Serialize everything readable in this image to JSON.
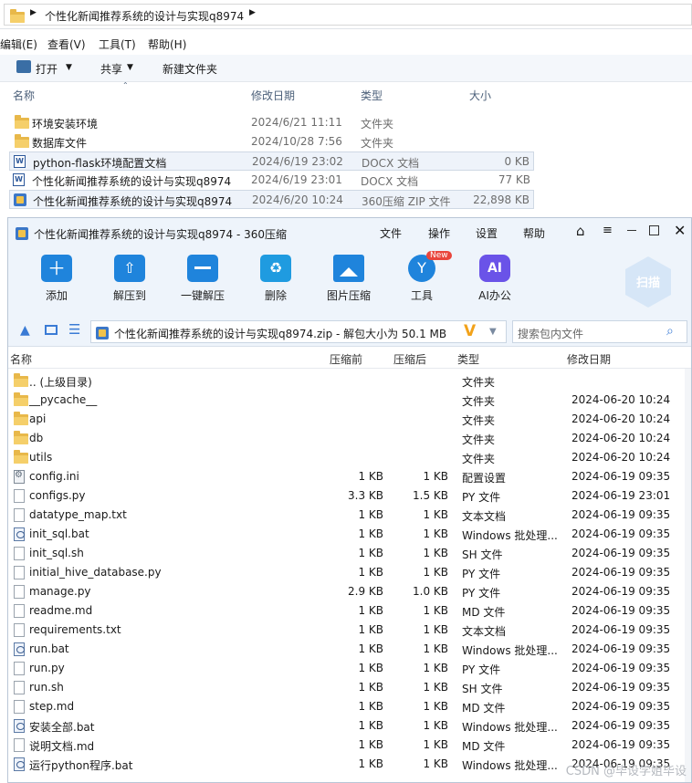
{
  "explorer": {
    "breadcrumb": "个性化新闻推荐系统的设计与实现q8974",
    "menu": [
      "编辑(E)",
      "查看(V)",
      "工具(T)",
      "帮助(H)"
    ],
    "toolbar": {
      "open": "打开",
      "share": "共享",
      "new_folder": "新建文件夹"
    },
    "columns": {
      "name": "名称",
      "date": "修改日期",
      "type": "类型",
      "size": "大小"
    },
    "rows": [
      {
        "name": "环境安装环境",
        "date": "2024/6/21 11:11",
        "type": "文件夹",
        "size": "",
        "icon": "folder-icon"
      },
      {
        "name": "数据库文件",
        "date": "2024/10/28 7:56",
        "type": "文件夹",
        "size": "",
        "icon": "folder-icon"
      },
      {
        "name": "python-flask环境配置文档",
        "date": "2024/6/19 23:02",
        "type": "DOCX 文档",
        "size": "0 KB",
        "icon": "word-icon"
      },
      {
        "name": "个性化新闻推荐系统的设计与实现q8974",
        "date": "2024/6/19 23:01",
        "type": "DOCX 文档",
        "size": "77 KB",
        "icon": "word-icon"
      },
      {
        "name": "个性化新闻推荐系统的设计与实现q8974",
        "date": "2024/6/20 10:24",
        "type": "360压缩 ZIP 文件",
        "size": "22,898 KB",
        "icon": "zip-icon"
      }
    ]
  },
  "zip": {
    "title": "个性化新闻推荐系统的设计与实现q8974 - 360压缩",
    "menu": [
      "文件",
      "操作",
      "设置",
      "帮助"
    ],
    "toolbar": [
      {
        "label": "添加",
        "icon": "add-icon"
      },
      {
        "label": "解压到",
        "icon": "extract-to-icon"
      },
      {
        "label": "一键解压",
        "icon": "one-click-extract-icon"
      },
      {
        "label": "删除",
        "icon": "delete-icon"
      },
      {
        "label": "图片压缩",
        "icon": "image-compress-icon"
      },
      {
        "label": "工具",
        "icon": "tools-icon"
      },
      {
        "label": "AI办公",
        "icon": "ai-office-icon"
      }
    ],
    "new_badge": "New",
    "ai_glyph": "AI",
    "scan_label": "扫描",
    "path": "个性化新闻推荐系统的设计与实现q8974.zip - 解包大小为 50.1 MB",
    "search_placeholder": "搜索包内文件",
    "columns": {
      "name": "名称",
      "before": "压缩前",
      "after": "压缩后",
      "type": "类型",
      "date": "修改日期"
    },
    "rows": [
      {
        "name": ".. (上级目录)",
        "before": "",
        "after": "",
        "type": "文件夹",
        "date": "",
        "icon": "folder"
      },
      {
        "name": "__pycache__",
        "before": "",
        "after": "",
        "type": "文件夹",
        "date": "2024-06-20 10:24",
        "icon": "folder"
      },
      {
        "name": "api",
        "before": "",
        "after": "",
        "type": "文件夹",
        "date": "2024-06-20 10:24",
        "icon": "folder"
      },
      {
        "name": "db",
        "before": "",
        "after": "",
        "type": "文件夹",
        "date": "2024-06-20 10:24",
        "icon": "folder"
      },
      {
        "name": "utils",
        "before": "",
        "after": "",
        "type": "文件夹",
        "date": "2024-06-20 10:24",
        "icon": "folder"
      },
      {
        "name": "config.ini",
        "before": "1 KB",
        "after": "1 KB",
        "type": "配置设置",
        "date": "2024-06-19 09:35",
        "icon": "gear"
      },
      {
        "name": "configs.py",
        "before": "3.3 KB",
        "after": "1.5 KB",
        "type": "PY 文件",
        "date": "2024-06-19 23:01",
        "icon": "file"
      },
      {
        "name": "datatype_map.txt",
        "before": "1 KB",
        "after": "1 KB",
        "type": "文本文档",
        "date": "2024-06-19 09:35",
        "icon": "file"
      },
      {
        "name": "init_sql.bat",
        "before": "1 KB",
        "after": "1 KB",
        "type": "Windows 批处理...",
        "date": "2024-06-19 09:35",
        "icon": "bat"
      },
      {
        "name": "init_sql.sh",
        "before": "1 KB",
        "after": "1 KB",
        "type": "SH 文件",
        "date": "2024-06-19 09:35",
        "icon": "file"
      },
      {
        "name": "initial_hive_database.py",
        "before": "1 KB",
        "after": "1 KB",
        "type": "PY 文件",
        "date": "2024-06-19 09:35",
        "icon": "file"
      },
      {
        "name": "manage.py",
        "before": "2.9 KB",
        "after": "1.0 KB",
        "type": "PY 文件",
        "date": "2024-06-19 09:35",
        "icon": "file"
      },
      {
        "name": "readme.md",
        "before": "1 KB",
        "after": "1 KB",
        "type": "MD 文件",
        "date": "2024-06-19 09:35",
        "icon": "file"
      },
      {
        "name": "requirements.txt",
        "before": "1 KB",
        "after": "1 KB",
        "type": "文本文档",
        "date": "2024-06-19 09:35",
        "icon": "file"
      },
      {
        "name": "run.bat",
        "before": "1 KB",
        "after": "1 KB",
        "type": "Windows 批处理...",
        "date": "2024-06-19 09:35",
        "icon": "bat"
      },
      {
        "name": "run.py",
        "before": "1 KB",
        "after": "1 KB",
        "type": "PY 文件",
        "date": "2024-06-19 09:35",
        "icon": "file"
      },
      {
        "name": "run.sh",
        "before": "1 KB",
        "after": "1 KB",
        "type": "SH 文件",
        "date": "2024-06-19 09:35",
        "icon": "file"
      },
      {
        "name": "step.md",
        "before": "1 KB",
        "after": "1 KB",
        "type": "MD 文件",
        "date": "2024-06-19 09:35",
        "icon": "file"
      },
      {
        "name": "安装全部.bat",
        "before": "1 KB",
        "after": "1 KB",
        "type": "Windows 批处理...",
        "date": "2024-06-19 09:35",
        "icon": "bat"
      },
      {
        "name": "说明文档.md",
        "before": "1 KB",
        "after": "1 KB",
        "type": "MD 文件",
        "date": "2024-06-19 09:35",
        "icon": "file"
      },
      {
        "name": "运行python程序.bat",
        "before": "1 KB",
        "after": "1 KB",
        "type": "Windows 批处理...",
        "date": "2024-06-19 09:35",
        "icon": "bat"
      }
    ]
  },
  "watermark": "CSDN @毕设学姐毕设",
  "colors": {
    "accent": "#1f84dc",
    "toolbar_bg": "#eef4fb",
    "badge": "#e9453c",
    "v_logo": "#f2a21a"
  }
}
